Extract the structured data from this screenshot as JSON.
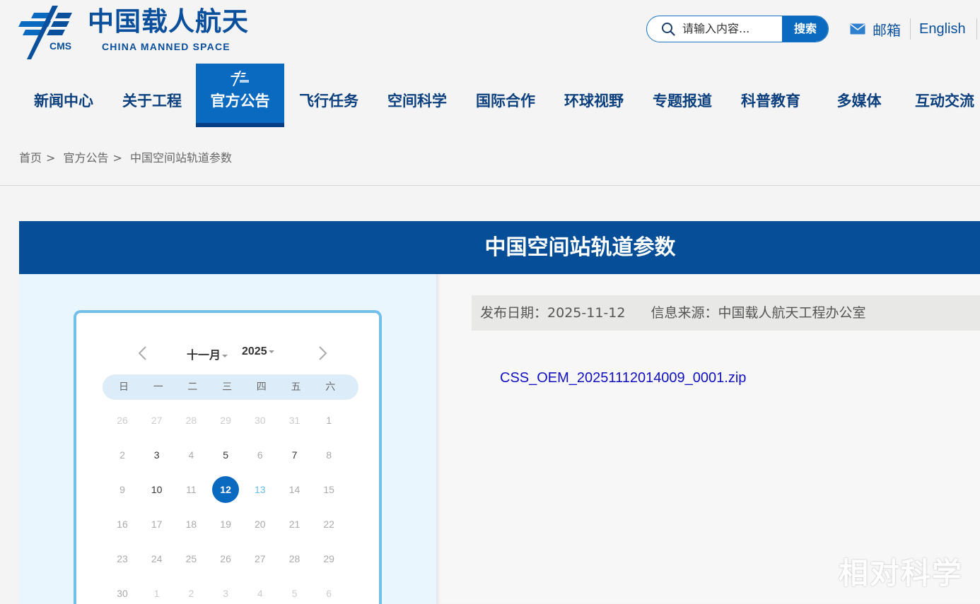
{
  "header": {
    "logo_cn": "中国载人航天",
    "logo_en": "CHINA MANNED SPACE",
    "logo_abbr": "CMS",
    "search_placeholder": "请输入内容...",
    "search_button": "搜索",
    "mail_label": "邮箱",
    "english_label": "English",
    "brand_color": "#0a4f9c",
    "accent_color": "#0a6ac0"
  },
  "nav": {
    "items": [
      {
        "label": "新闻中心"
      },
      {
        "label": "关于工程"
      },
      {
        "label": "官方公告",
        "active": true
      },
      {
        "label": "飞行任务"
      },
      {
        "label": "空间科学"
      },
      {
        "label": "国际合作"
      },
      {
        "label": "环球视野"
      },
      {
        "label": "专题报道"
      },
      {
        "label": "科普教育"
      },
      {
        "label": "多媒体"
      },
      {
        "label": "互动交流"
      }
    ]
  },
  "breadcrumb": {
    "items": [
      "首页",
      "官方公告",
      "中国空间站轨道参数"
    ],
    "separator": ">"
  },
  "article": {
    "title": "中国空间站轨道参数",
    "publish_date_label": "发布日期：",
    "publish_date": "2025-11-12",
    "source_label": "信息来源：",
    "source": "中国载人航天工程办公室",
    "attachment": "CSS_OEM_20251112014009_0001.zip"
  },
  "calendar": {
    "month": "十一月",
    "year": "2025",
    "weekdays": [
      "日",
      "一",
      "二",
      "三",
      "四",
      "五",
      "六"
    ],
    "selected_day": "12",
    "weeks": [
      [
        "26",
        "27",
        "28",
        "29",
        "30",
        "31",
        "1"
      ],
      [
        "2",
        "3",
        "4",
        "5",
        "6",
        "7",
        "8"
      ],
      [
        "9",
        "10",
        "11",
        "12",
        "13",
        "14",
        "15"
      ],
      [
        "16",
        "17",
        "18",
        "19",
        "20",
        "21",
        "22"
      ],
      [
        "23",
        "24",
        "25",
        "26",
        "27",
        "28",
        "29"
      ],
      [
        "30",
        "1",
        "2",
        "3",
        "4",
        "5",
        "6"
      ]
    ]
  },
  "watermark": "相对科学"
}
